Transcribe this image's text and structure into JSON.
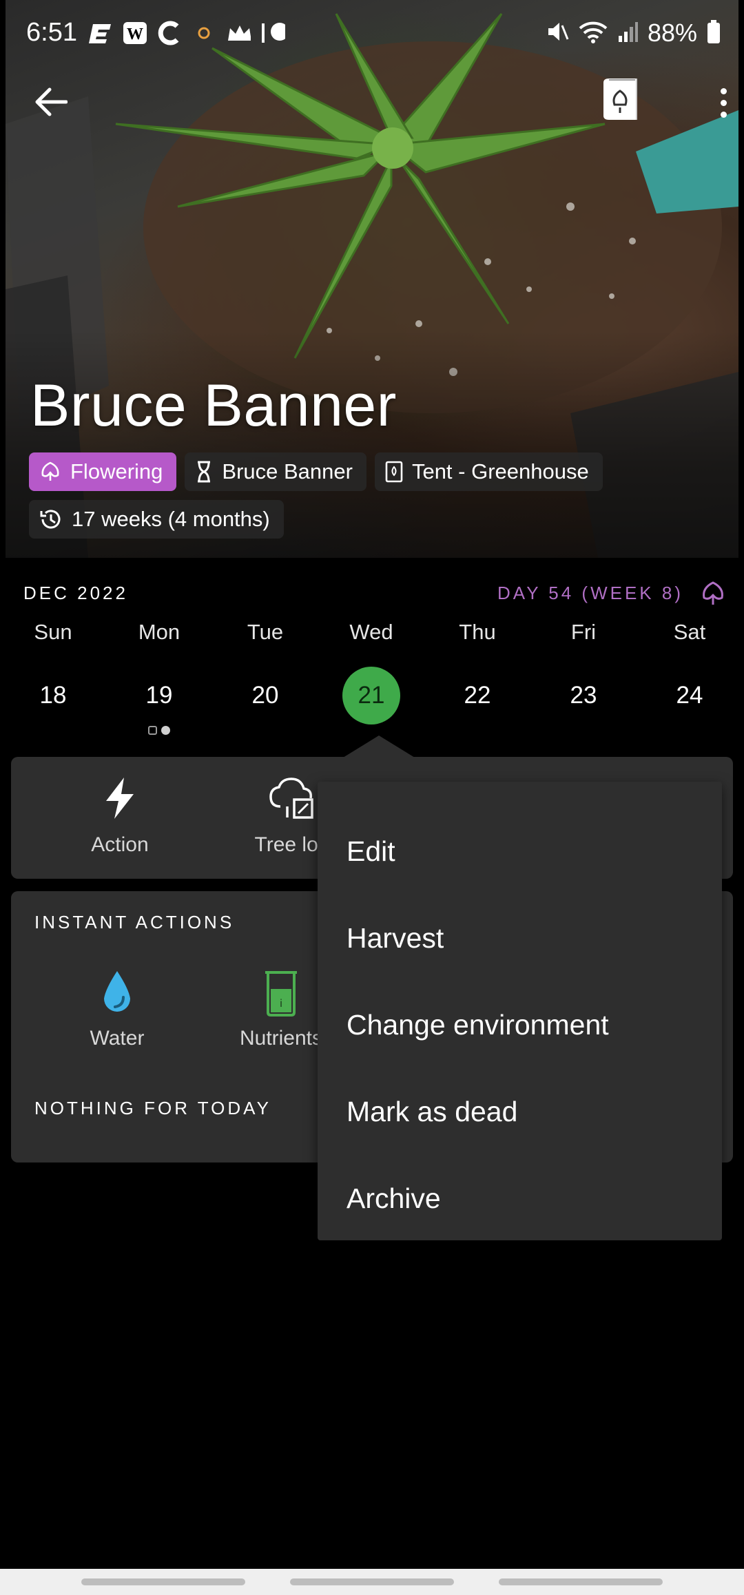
{
  "status_bar": {
    "time": "6:51",
    "battery": "88%",
    "left_icons": [
      "espn-icon",
      "wapo-icon",
      "c-icon",
      "sun-icon",
      "crown-icon",
      "dot-icon"
    ],
    "right_icons": [
      "mute-icon",
      "wifi-icon",
      "signal-icon",
      "battery-icon"
    ]
  },
  "header": {
    "title": "Bruce Banner",
    "chips": [
      {
        "label": "Flowering",
        "icon": "flowering-icon",
        "color": "#b659c9"
      },
      {
        "label": "Bruce Banner",
        "icon": "strain-icon"
      },
      {
        "label": "Tent - Greenhouse",
        "icon": "tent-icon"
      }
    ],
    "age_chip": {
      "label": "17 weeks (4 months)",
      "icon": "history-icon"
    }
  },
  "calendar": {
    "month": "DEC 2022",
    "day_info": "DAY 54 (WEEK 8)",
    "accent": "#b06fc4",
    "selected_color": "#3faa4a",
    "days": [
      {
        "name": "Sun",
        "date": "18"
      },
      {
        "name": "Mon",
        "date": "19"
      },
      {
        "name": "Tue",
        "date": "20"
      },
      {
        "name": "Wed",
        "date": "21"
      },
      {
        "name": "Thu",
        "date": "22"
      },
      {
        "name": "Fri",
        "date": "23"
      },
      {
        "name": "Sat",
        "date": "24"
      }
    ],
    "selected_date": "21"
  },
  "actions": {
    "action_label": "Action",
    "tree_log_label": "Tree log"
  },
  "instant_actions": {
    "title": "INSTANT ACTIONS",
    "water_label": "Water",
    "nutrients_label": "Nutrients",
    "nothing_label": "NOTHING FOR TODAY"
  },
  "menu": {
    "items": [
      "Edit",
      "Harvest",
      "Change environment",
      "Mark as dead",
      "Archive"
    ]
  }
}
